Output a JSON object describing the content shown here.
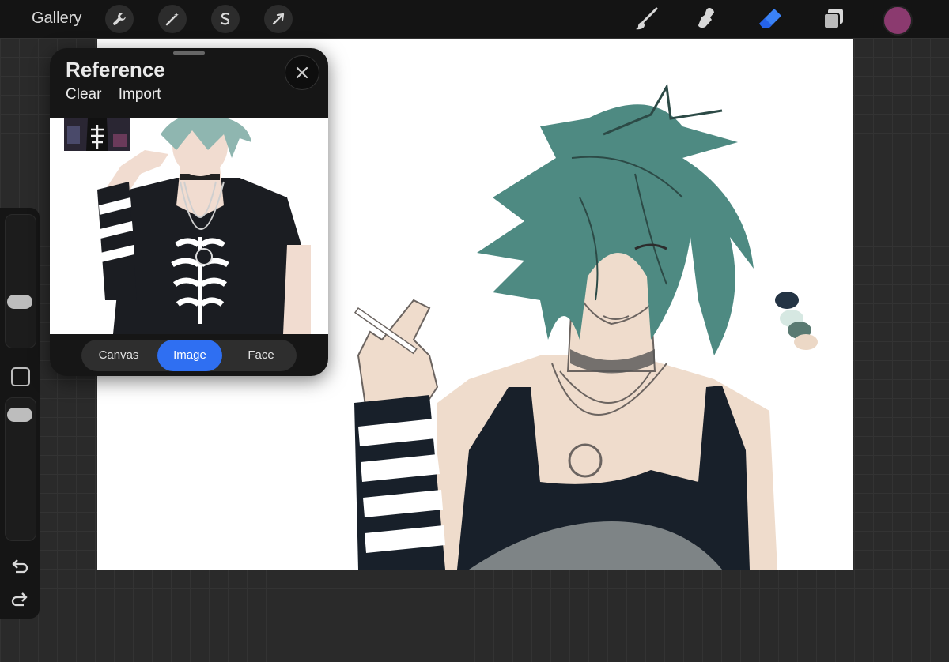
{
  "topbar": {
    "gallery_label": "Gallery",
    "left_tools": [
      "wrench-icon",
      "magic-wand-icon",
      "selection-icon",
      "transform-icon"
    ],
    "right_tools": [
      "brush-icon",
      "smudge-icon",
      "eraser-icon",
      "layers-icon"
    ],
    "active_tool": "eraser",
    "current_color": "#8b3a6f",
    "accent_color": "#2f6ff2"
  },
  "reference": {
    "title": "Reference",
    "clear_label": "Clear",
    "import_label": "Import",
    "tabs": [
      {
        "label": "Canvas",
        "active": false
      },
      {
        "label": "Image",
        "active": true
      },
      {
        "label": "Face",
        "active": false
      }
    ]
  },
  "sidebar": {
    "brush_size": 0.35,
    "opacity": 0.95
  },
  "canvas": {
    "palette_swatches": [
      "#243444",
      "#d6e8e2",
      "#5a7a72",
      "#ecd8c6"
    ]
  }
}
